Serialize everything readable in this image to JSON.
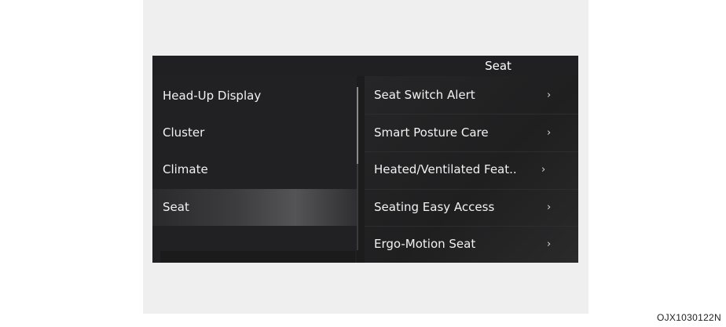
{
  "header": {
    "title": "Seat"
  },
  "left_menu": {
    "items": [
      {
        "label": "Head-Up Display"
      },
      {
        "label": "Cluster"
      },
      {
        "label": "Climate"
      },
      {
        "label": "Seat",
        "selected": true
      }
    ]
  },
  "right_menu": {
    "chevron": "›",
    "items": [
      {
        "label": "Seat Switch Alert"
      },
      {
        "label": "Smart Posture Care"
      },
      {
        "label": "Heated/Ventilated Feat.."
      },
      {
        "label": "Seating Easy Access"
      },
      {
        "label": "Ergo-Motion Seat"
      }
    ]
  },
  "figure_code": "OJX1030122N",
  "colors": {
    "background": "#efefef",
    "screen": "#1c1c1d",
    "text": "#f2f2f2"
  }
}
